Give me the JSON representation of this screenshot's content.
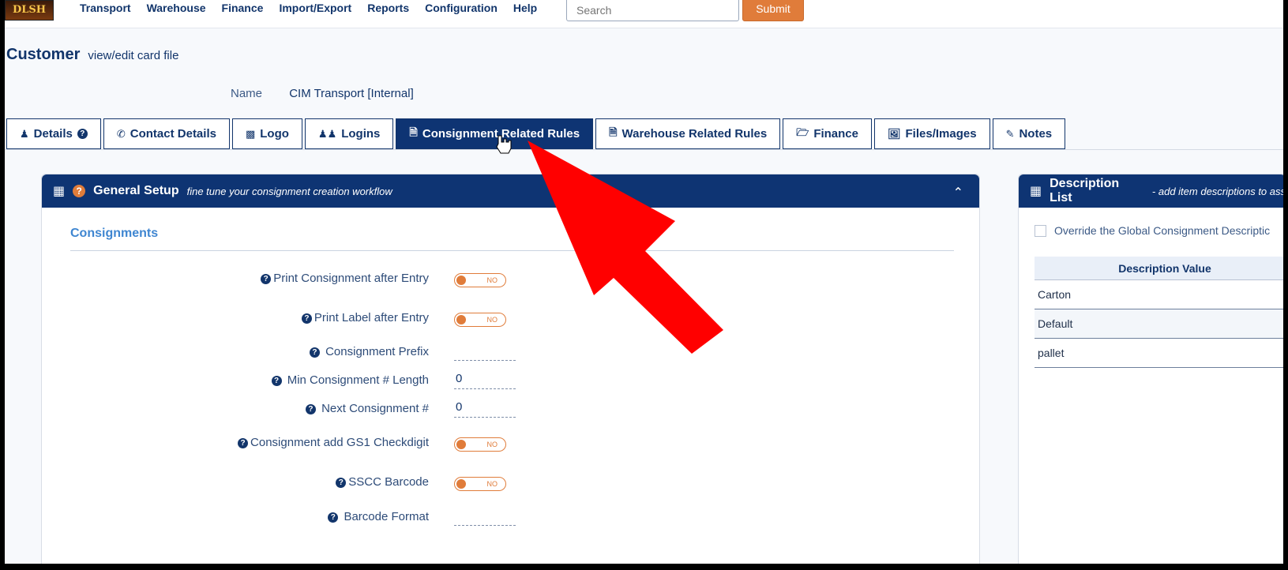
{
  "nav": {
    "logo_text": "DLSH",
    "menu": [
      "Transport",
      "Warehouse",
      "Finance",
      "Import/Export",
      "Reports",
      "Configuration",
      "Help"
    ],
    "search_placeholder": "Search",
    "submit_label": "Submit"
  },
  "page": {
    "title": "Customer",
    "subtitle": "view/edit card file",
    "name_label": "Name",
    "name_value": "CIM Transport [Internal]"
  },
  "tabs": [
    {
      "label": "Details",
      "icon": "user-icon",
      "active": false
    },
    {
      "label": "Contact Details",
      "icon": "phone-icon",
      "active": false
    },
    {
      "label": "Logo",
      "icon": "image-icon",
      "active": false
    },
    {
      "label": "Logins",
      "icon": "users-icon",
      "active": false
    },
    {
      "label": "Consignment Related Rules",
      "icon": "file-icon",
      "active": true
    },
    {
      "label": "Warehouse Related Rules",
      "icon": "file-icon",
      "active": false
    },
    {
      "label": "Finance",
      "icon": "folder-icon",
      "active": false
    },
    {
      "label": "Files/Images",
      "icon": "file-image-icon",
      "active": false
    },
    {
      "label": "Notes",
      "icon": "pencil-icon",
      "active": false
    }
  ],
  "general": {
    "title": "General Setup",
    "subtitle": "fine tune your consignment creation workflow",
    "section": "Consignments",
    "rows": [
      {
        "label": "Print Consignment after Entry",
        "type": "toggle",
        "value": "NO"
      },
      {
        "label": "Print Label after Entry",
        "type": "toggle",
        "value": "NO"
      },
      {
        "label": "Consignment Prefix",
        "type": "field",
        "value": ""
      },
      {
        "label": "Min Consignment # Length",
        "type": "field",
        "value": "0"
      },
      {
        "label": "Next Consignment #",
        "type": "field",
        "value": "0"
      },
      {
        "label": "Consignment add GS1 Checkdigit",
        "type": "toggle",
        "value": "NO"
      },
      {
        "label": "SSCC Barcode",
        "type": "toggle",
        "value": "NO"
      },
      {
        "label": "Barcode Format",
        "type": "field",
        "value": ""
      }
    ]
  },
  "description": {
    "title": "Description List",
    "subtitle": "- add item descriptions to ass",
    "override_label": "Override the Global Consignment Descriptic",
    "column": "Description Value",
    "values": [
      "Carton",
      "Default",
      "pallet"
    ]
  },
  "colors": {
    "navy": "#0e3473",
    "orange": "#e07c3a",
    "arrow": "#ff0000"
  }
}
